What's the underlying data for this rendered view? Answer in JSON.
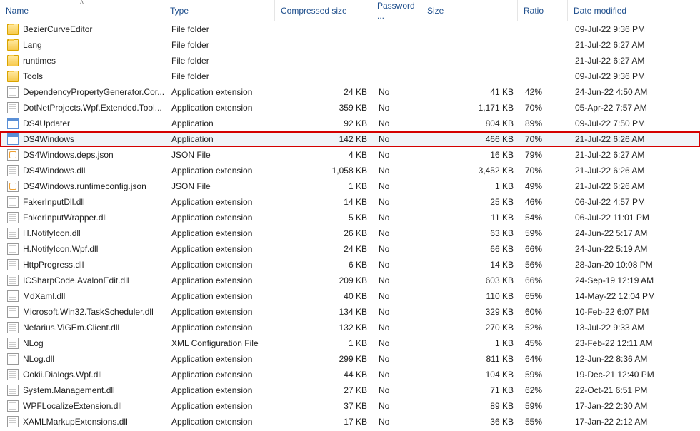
{
  "columns": {
    "name": "Name",
    "type": "Type",
    "csize": "Compressed size",
    "pw": "Password ...",
    "size": "Size",
    "ratio": "Ratio",
    "date": "Date modified"
  },
  "sort": {
    "column": "name",
    "direction": "asc"
  },
  "highlighted_index": 7,
  "rows": [
    {
      "icon": "folder",
      "name": "BezierCurveEditor",
      "type": "File folder",
      "csize": "",
      "pw": "",
      "size": "",
      "ratio": "",
      "date": "09-Jul-22 9:36 PM"
    },
    {
      "icon": "folder",
      "name": "Lang",
      "type": "File folder",
      "csize": "",
      "pw": "",
      "size": "",
      "ratio": "",
      "date": "21-Jul-22 6:27 AM"
    },
    {
      "icon": "folder",
      "name": "runtimes",
      "type": "File folder",
      "csize": "",
      "pw": "",
      "size": "",
      "ratio": "",
      "date": "21-Jul-22 6:27 AM"
    },
    {
      "icon": "folder",
      "name": "Tools",
      "type": "File folder",
      "csize": "",
      "pw": "",
      "size": "",
      "ratio": "",
      "date": "09-Jul-22 9:36 PM"
    },
    {
      "icon": "file",
      "name": "DependencyPropertyGenerator.Cor...",
      "type": "Application extension",
      "csize": "24 KB",
      "pw": "No",
      "size": "41 KB",
      "ratio": "42%",
      "date": "24-Jun-22 4:50 AM"
    },
    {
      "icon": "file",
      "name": "DotNetProjects.Wpf.Extended.Tool...",
      "type": "Application extension",
      "csize": "359 KB",
      "pw": "No",
      "size": "1,171 KB",
      "ratio": "70%",
      "date": "05-Apr-22 7:57 AM"
    },
    {
      "icon": "app",
      "name": "DS4Updater",
      "type": "Application",
      "csize": "92 KB",
      "pw": "No",
      "size": "804 KB",
      "ratio": "89%",
      "date": "09-Jul-22 7:50 PM"
    },
    {
      "icon": "app",
      "name": "DS4Windows",
      "type": "Application",
      "csize": "142 KB",
      "pw": "No",
      "size": "466 KB",
      "ratio": "70%",
      "date": "21-Jul-22 6:26 AM"
    },
    {
      "icon": "json",
      "name": "DS4Windows.deps.json",
      "type": "JSON File",
      "csize": "4 KB",
      "pw": "No",
      "size": "16 KB",
      "ratio": "79%",
      "date": "21-Jul-22 6:27 AM"
    },
    {
      "icon": "file",
      "name": "DS4Windows.dll",
      "type": "Application extension",
      "csize": "1,058 KB",
      "pw": "No",
      "size": "3,452 KB",
      "ratio": "70%",
      "date": "21-Jul-22 6:26 AM"
    },
    {
      "icon": "json",
      "name": "DS4Windows.runtimeconfig.json",
      "type": "JSON File",
      "csize": "1 KB",
      "pw": "No",
      "size": "1 KB",
      "ratio": "49%",
      "date": "21-Jul-22 6:26 AM"
    },
    {
      "icon": "file",
      "name": "FakerInputDll.dll",
      "type": "Application extension",
      "csize": "14 KB",
      "pw": "No",
      "size": "25 KB",
      "ratio": "46%",
      "date": "06-Jul-22 4:57 PM"
    },
    {
      "icon": "file",
      "name": "FakerInputWrapper.dll",
      "type": "Application extension",
      "csize": "5 KB",
      "pw": "No",
      "size": "11 KB",
      "ratio": "54%",
      "date": "06-Jul-22 11:01 PM"
    },
    {
      "icon": "file",
      "name": "H.NotifyIcon.dll",
      "type": "Application extension",
      "csize": "26 KB",
      "pw": "No",
      "size": "63 KB",
      "ratio": "59%",
      "date": "24-Jun-22 5:17 AM"
    },
    {
      "icon": "file",
      "name": "H.NotifyIcon.Wpf.dll",
      "type": "Application extension",
      "csize": "24 KB",
      "pw": "No",
      "size": "66 KB",
      "ratio": "66%",
      "date": "24-Jun-22 5:19 AM"
    },
    {
      "icon": "file",
      "name": "HttpProgress.dll",
      "type": "Application extension",
      "csize": "6 KB",
      "pw": "No",
      "size": "14 KB",
      "ratio": "56%",
      "date": "28-Jan-20 10:08 PM"
    },
    {
      "icon": "file",
      "name": "ICSharpCode.AvalonEdit.dll",
      "type": "Application extension",
      "csize": "209 KB",
      "pw": "No",
      "size": "603 KB",
      "ratio": "66%",
      "date": "24-Sep-19 12:19 AM"
    },
    {
      "icon": "file",
      "name": "MdXaml.dll",
      "type": "Application extension",
      "csize": "40 KB",
      "pw": "No",
      "size": "110 KB",
      "ratio": "65%",
      "date": "14-May-22 12:04 PM"
    },
    {
      "icon": "file",
      "name": "Microsoft.Win32.TaskScheduler.dll",
      "type": "Application extension",
      "csize": "134 KB",
      "pw": "No",
      "size": "329 KB",
      "ratio": "60%",
      "date": "10-Feb-22 6:07 PM"
    },
    {
      "icon": "file",
      "name": "Nefarius.ViGEm.Client.dll",
      "type": "Application extension",
      "csize": "132 KB",
      "pw": "No",
      "size": "270 KB",
      "ratio": "52%",
      "date": "13-Jul-22 9:33 AM"
    },
    {
      "icon": "file",
      "name": "NLog",
      "type": "XML Configuration File",
      "csize": "1 KB",
      "pw": "No",
      "size": "1 KB",
      "ratio": "45%",
      "date": "23-Feb-22 12:11 AM"
    },
    {
      "icon": "file",
      "name": "NLog.dll",
      "type": "Application extension",
      "csize": "299 KB",
      "pw": "No",
      "size": "811 KB",
      "ratio": "64%",
      "date": "12-Jun-22 8:36 AM"
    },
    {
      "icon": "file",
      "name": "Ookii.Dialogs.Wpf.dll",
      "type": "Application extension",
      "csize": "44 KB",
      "pw": "No",
      "size": "104 KB",
      "ratio": "59%",
      "date": "19-Dec-21 12:40 PM"
    },
    {
      "icon": "file",
      "name": "System.Management.dll",
      "type": "Application extension",
      "csize": "27 KB",
      "pw": "No",
      "size": "71 KB",
      "ratio": "62%",
      "date": "22-Oct-21 6:51 PM"
    },
    {
      "icon": "file",
      "name": "WPFLocalizeExtension.dll",
      "type": "Application extension",
      "csize": "37 KB",
      "pw": "No",
      "size": "89 KB",
      "ratio": "59%",
      "date": "17-Jan-22 2:30 AM"
    },
    {
      "icon": "file",
      "name": "XAMLMarkupExtensions.dll",
      "type": "Application extension",
      "csize": "17 KB",
      "pw": "No",
      "size": "36 KB",
      "ratio": "55%",
      "date": "17-Jan-22 2:12 AM"
    }
  ]
}
